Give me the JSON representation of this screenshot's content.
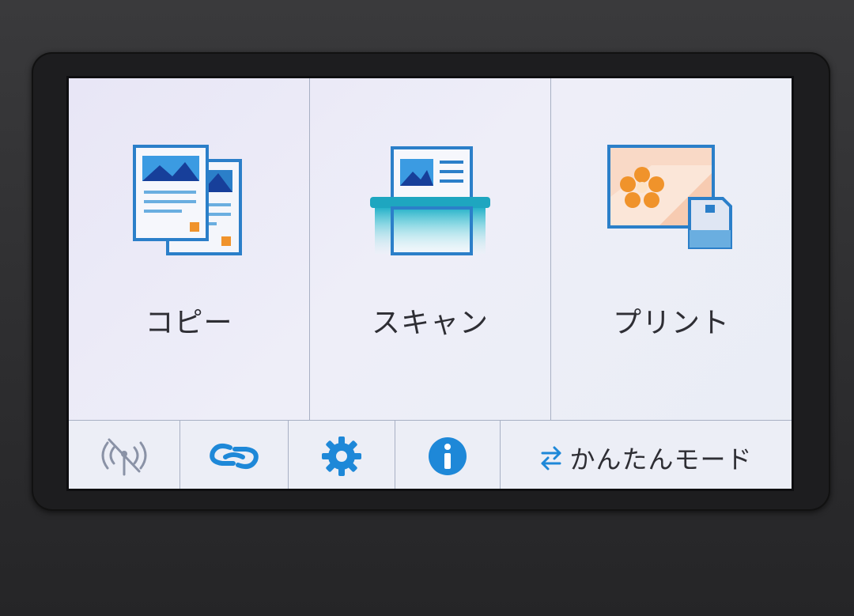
{
  "menu": {
    "tiles": [
      {
        "label": "コピー",
        "icon": "copy-icon"
      },
      {
        "label": "スキャン",
        "icon": "scan-icon"
      },
      {
        "label": "プリント",
        "icon": "print-photo-icon"
      }
    ]
  },
  "bottom_bar": {
    "wireless_icon": "wireless-off-icon",
    "connect_icon": "link-icon",
    "settings_icon": "gear-icon",
    "info_icon": "info-icon",
    "mode_label": "かんたんモード",
    "mode_icon": "swap-arrows-icon"
  },
  "colors": {
    "accent_blue": "#1e88d8",
    "icon_outline": "#2b7fc9",
    "orange": "#f0932b",
    "screen_bg": "#eceef6"
  }
}
